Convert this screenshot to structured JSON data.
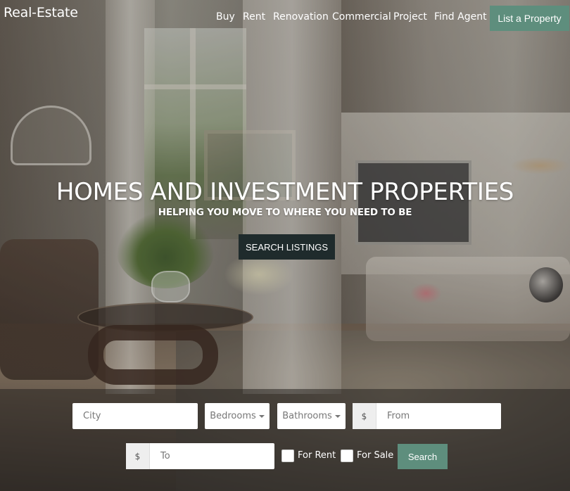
{
  "brand": "Real-Estate",
  "nav": {
    "items": [
      "Buy",
      "Rent",
      "Renovation",
      "Commercial",
      "Project",
      "Find Agent"
    ],
    "cta": "List a Property"
  },
  "hero": {
    "headline": "HOMES AND INVESTMENT PROPERTIES",
    "subline": "HELPING YOU MOVE TO WHERE YOU NEED TO BE",
    "button": "SEARCH LISTINGS"
  },
  "search": {
    "city_placeholder": "City",
    "bedrooms": "Bedrooms",
    "bathrooms": "Bathrooms",
    "currency": "$",
    "from_placeholder": "From",
    "to_placeholder": "To",
    "for_rent": "For Rent",
    "for_sale": "For Sale",
    "button": "Search"
  }
}
